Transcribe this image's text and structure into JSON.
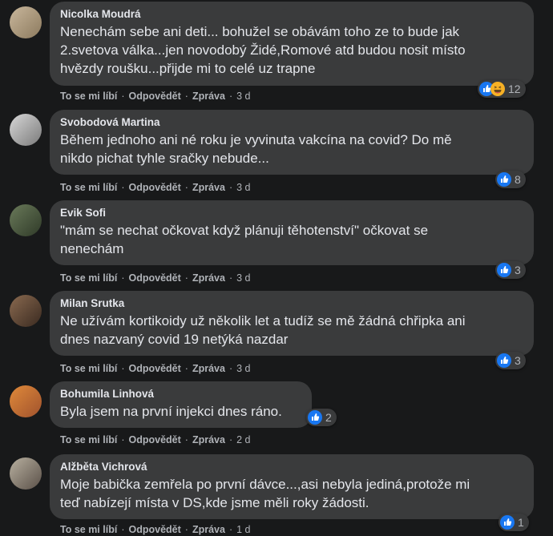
{
  "actions": {
    "like": "To se mi líbí",
    "reply": "Odpovědět",
    "share": "Zpráva",
    "sep": "·"
  },
  "colors": {
    "bubble": "#3a3b3c",
    "bg": "#18191a",
    "like": "#1877f2",
    "haha": "#f7b125"
  },
  "comments": [
    {
      "author": "Nicolka Moudrá",
      "text": "Nenechám sebe ani deti... bohužel se obávám toho ze to bude jak\n2.svetova válka...jen novodobý Židé,Romové atd budou nosit místo\nhvězdy roušku...přijde mi to celé uz trapne",
      "time": "3 d",
      "reactions": "12",
      "reaction_types": [
        "like-icon",
        "haha-icon"
      ]
    },
    {
      "author": "Svobodová Martina",
      "text": "Během jednoho ani né roku je vyvinuta vakcína na covid? Do mě\nnikdo pichat tyhle sračky nebude...",
      "time": "3 d",
      "reactions": "8",
      "reaction_types": [
        "like-icon"
      ]
    },
    {
      "author": "Evik Sofi",
      "text": "\"mám se nechat očkovat když plánuji těhotenství\" očkovat se\nnenechám",
      "time": "3 d",
      "reactions": "3",
      "reaction_types": [
        "like-icon"
      ]
    },
    {
      "author": "Milan Srutka",
      "text": "Ne užívám kortikoidy už několik let a tudíž se mě žádná chřipka ani\ndnes nazvaný covid 19 netýká nazdar",
      "time": "3 d",
      "reactions": "3",
      "reaction_types": [
        "like-icon"
      ]
    },
    {
      "author": "Bohumila Linhová",
      "text": "Byla jsem na první injekci dnes ráno.",
      "time": "2 d",
      "reactions": "2",
      "reaction_types": [
        "like-icon"
      ]
    },
    {
      "author": "Alžběta Vichrová",
      "text": "Moje babička zemřela po první dávce...,asi nebyla jediná,protože mi\nteď nabízejí místa v DS,kde jsme měli roky žádosti.",
      "time": "1 d",
      "reactions": "1",
      "reaction_types": [
        "like-icon"
      ]
    }
  ]
}
